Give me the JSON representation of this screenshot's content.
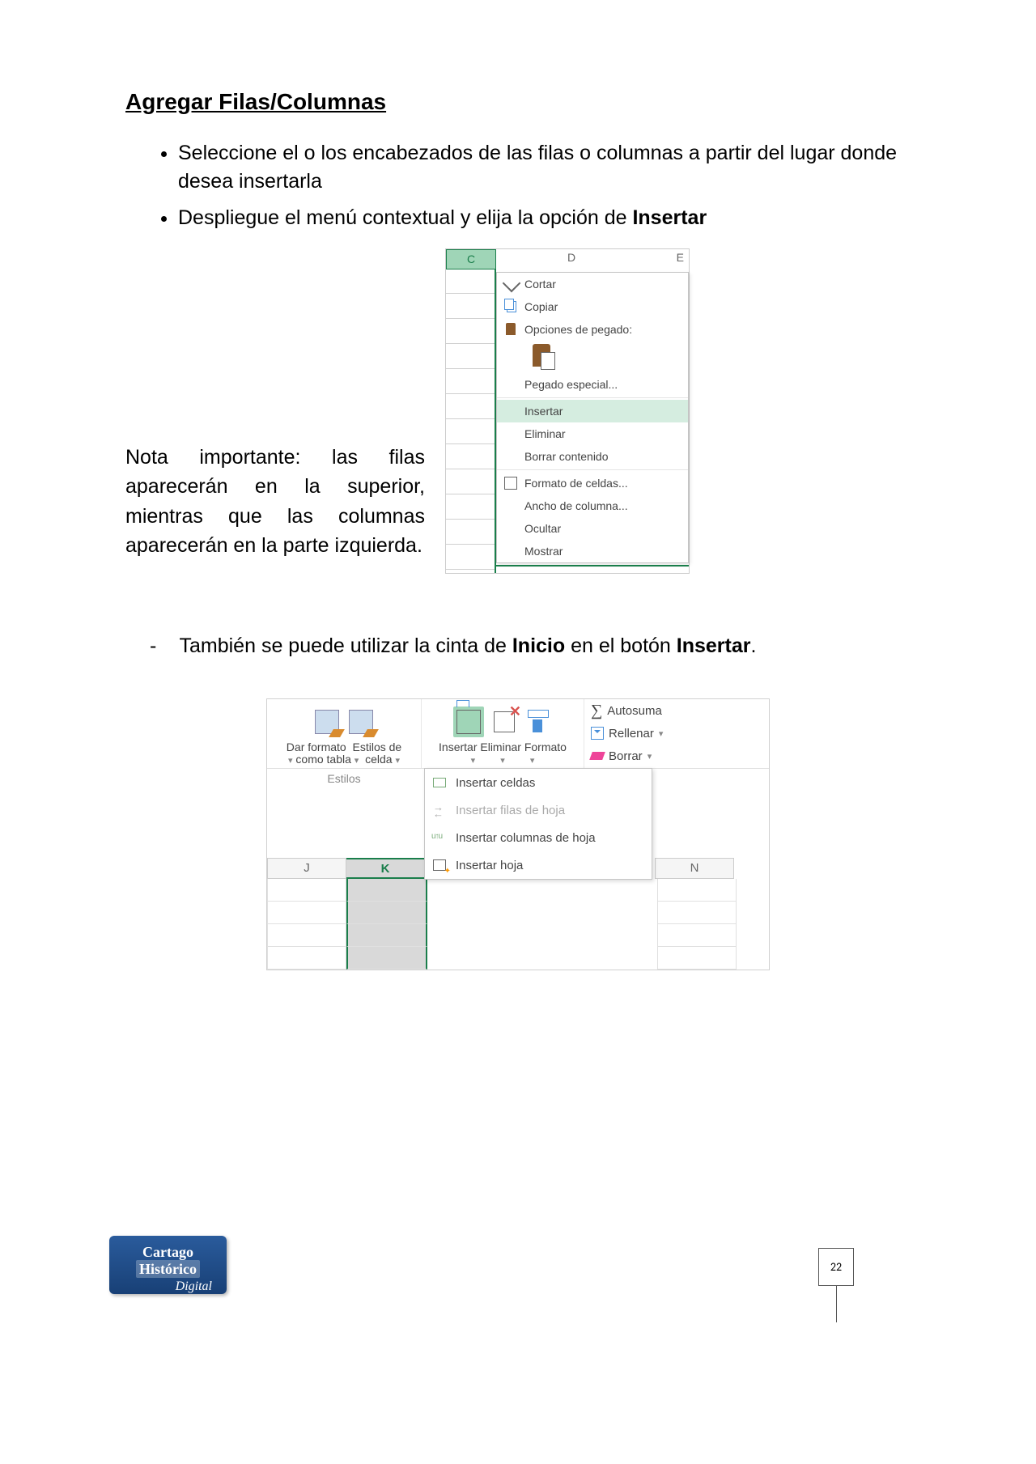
{
  "title": "Agregar Filas/Columnas",
  "bullets": {
    "b1a": "Seleccione el o los encabezados de las filas o columnas a partir del lugar donde desea insertarla",
    "b2a": "Despliegue el menú contextual  y elija la opción de ",
    "b2b": "Insertar"
  },
  "note": "Nota importante: las filas aparecerán en la superior, mientras que las columnas aparecerán en la parte izquierda.",
  "cols": {
    "c": "C",
    "d": "D",
    "e": "E"
  },
  "ctx": {
    "cut": "Cortar",
    "copy": "Copiar",
    "popt": "Opciones de pegado:",
    "pspecial": "Pegado especial...",
    "insert": "Insertar",
    "delete": "Eliminar",
    "clear": "Borrar contenido",
    "fmt": "Formato de celdas...",
    "width": "Ancho de columna...",
    "hide": "Ocultar",
    "show": "Mostrar"
  },
  "sub2": {
    "a": "También se puede utilizar la cinta de ",
    "b": "Inicio",
    "c": " en el botón ",
    "d": "Insertar",
    "e": "."
  },
  "ribbon": {
    "fmt_tbl": "Dar formato",
    "fmt_tbl2": "como tabla",
    "styles": "Estilos de",
    "styles2": "celda",
    "groupStyles": "Estilos",
    "insert": "Insertar",
    "delete": "Eliminar",
    "format": "Formato",
    "autosum": "Autosuma",
    "fill": "Rellenar",
    "clear": "Borrar"
  },
  "insmenu": {
    "cells": "Insertar celdas",
    "rows": "Insertar filas de hoja",
    "cols": "Insertar columnas de hoja",
    "sheet": "Insertar hoja"
  },
  "sheetcols": {
    "j": "J",
    "k": "K",
    "n": "N"
  },
  "badge": {
    "l1a": "Cartago",
    "l1b": "Histórico",
    "l2": "Digital"
  },
  "page": "22"
}
